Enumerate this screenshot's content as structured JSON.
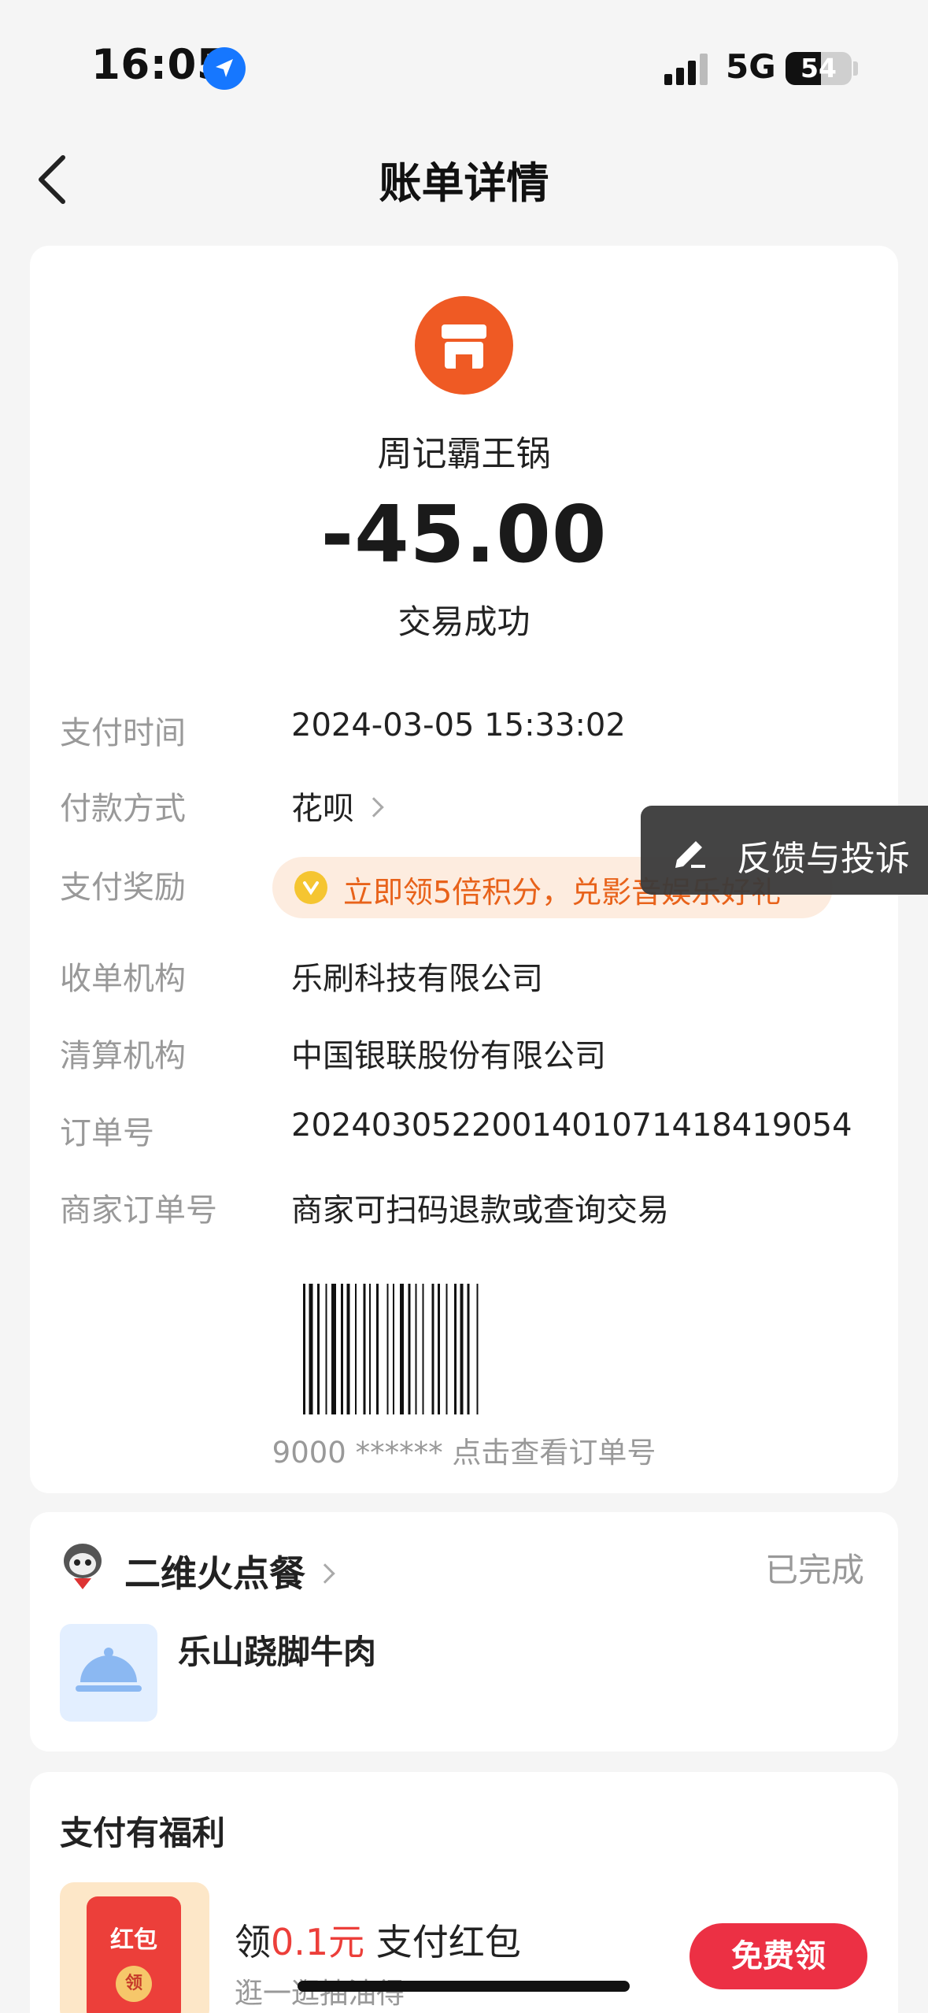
{
  "status_bar": {
    "time": "16:05",
    "network": "5G",
    "battery": "54",
    "battery_level": 0.54
  },
  "header": {
    "title": "账单详情"
  },
  "merchant": {
    "name": "周记霸王锅",
    "amount": "-45.00",
    "status": "交易成功",
    "icon": "store-icon",
    "icon_color": "#ef5a24"
  },
  "details": [
    {
      "label": "支付时间",
      "value": "2024-03-05 15:33:02"
    },
    {
      "label": "付款方式",
      "value": "花呗"
    },
    {
      "label": "支付奖励",
      "value": "立即领5倍积分，兑影音娱乐好礼"
    },
    {
      "label": "收单机构",
      "value": "乐刷科技有限公司"
    },
    {
      "label": "清算机构",
      "value": "中国银联股份有限公司"
    },
    {
      "label": "订单号",
      "value": "2024030522001401071418419054"
    },
    {
      "label": "商家订单号",
      "value": "商家可扫码退款或查询交易"
    }
  ],
  "barcode": {
    "caption": "9000 ****** 点击查看订单号"
  },
  "feedback": {
    "label": "反馈与投诉"
  },
  "service": {
    "name": "二维火点餐",
    "status": "已完成",
    "item": "乐山跷脚牛肉"
  },
  "benefit": {
    "title": "支付有福利",
    "badge": "红包",
    "seal": "领",
    "prefix": "领",
    "amount": "0.1元",
    "suffix": "支付红包",
    "sub": "逛一逛抽油得",
    "button": "免费领"
  },
  "colors": {
    "accent": "#ef5a24",
    "reward": "#e8621a",
    "button": "#ec3044"
  }
}
